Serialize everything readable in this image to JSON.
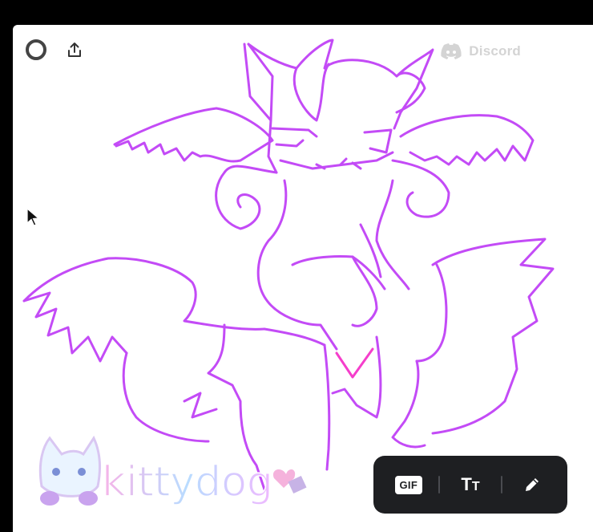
{
  "watermark": {
    "label": "Discord",
    "icon": "discord-logo-icon"
  },
  "logo": {
    "text": "kittydog"
  },
  "toolbar": {
    "gif_label": "GIF",
    "text_label_big": "T",
    "text_label_small": "T",
    "items": [
      "gif-button",
      "text-button",
      "draw-button"
    ]
  },
  "colors": {
    "stroke_purple": "#c34bf6",
    "stroke_pink": "#f53ecb",
    "toolbar_bg": "#1e1f22",
    "watermark": "#d4d4d4"
  }
}
